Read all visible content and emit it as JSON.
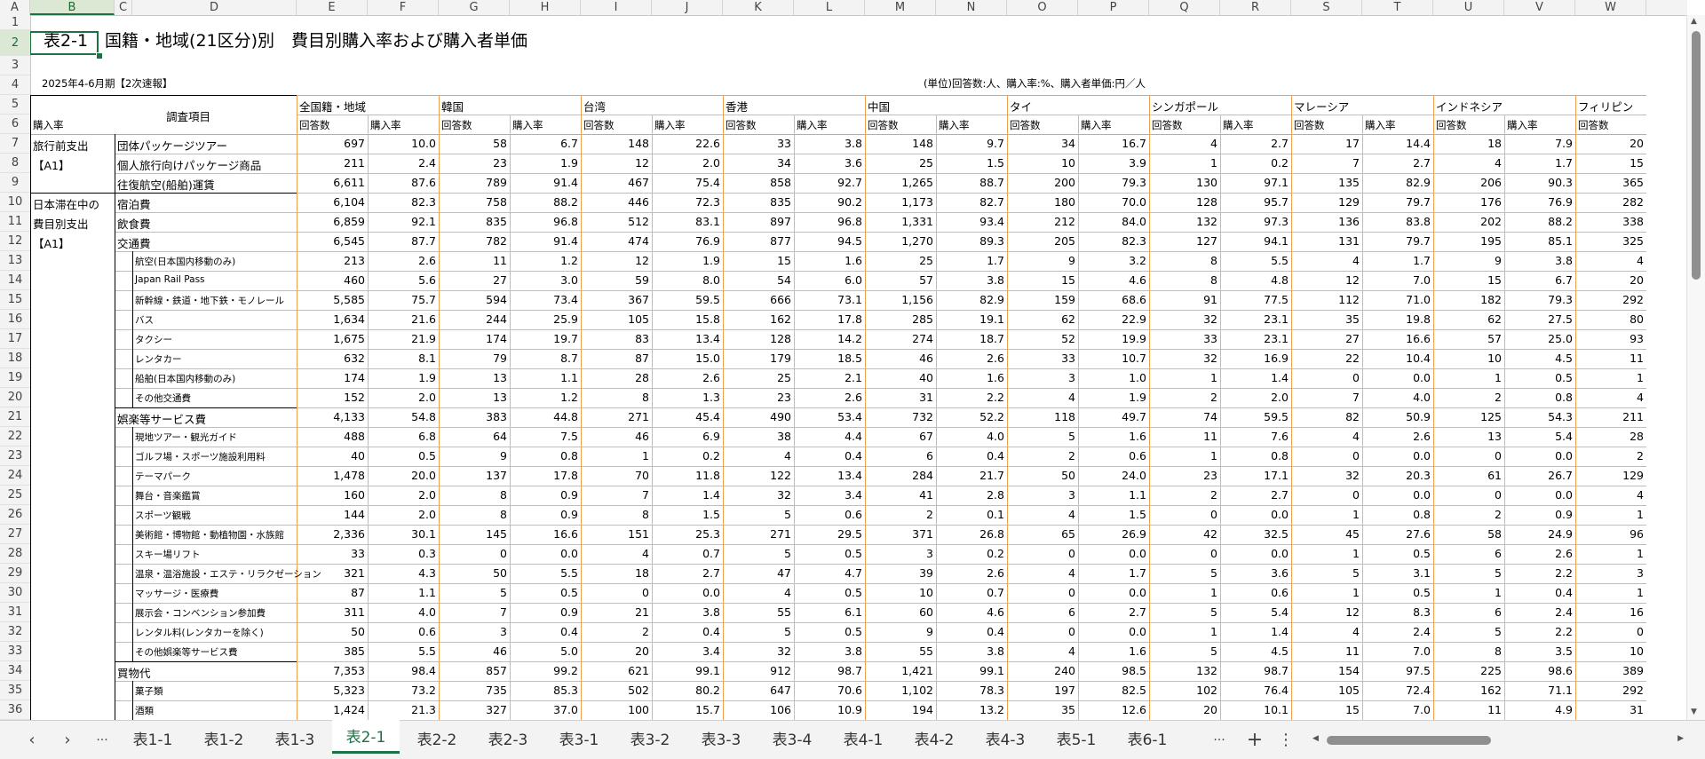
{
  "sheet": {
    "name_box_cell": "B2",
    "title": "表2-1　国籍・地域(21区分)別　費目別購入率および購入者単価",
    "period": "2025年4-6月期【2次速報】",
    "units": "(単位)回答数:人、購入率:%、購入者単価:円／人",
    "item_header": "調査項目",
    "sub_headers": [
      "回答数",
      "購入率"
    ],
    "countries": [
      "全国籍・地域",
      "韓国",
      "台湾",
      "香港",
      "中国",
      "タイ",
      "シンガポール",
      "マレーシア",
      "インドネシア",
      "フィリピン"
    ],
    "col_letters": [
      "A",
      "B",
      "C",
      "D",
      "E",
      "F",
      "G",
      "H",
      "I",
      "J",
      "K",
      "L",
      "M",
      "N",
      "O",
      "P",
      "Q",
      "R",
      "S",
      "T",
      "U",
      "V",
      "W"
    ],
    "row_numbers": [
      "1",
      "2",
      "3",
      "4",
      "5",
      "6",
      "7",
      "8",
      "9",
      "10",
      "11",
      "12",
      "13",
      "14",
      "15",
      "16",
      "17",
      "18",
      "19",
      "20",
      "21",
      "22",
      "23",
      "24",
      "25",
      "26",
      "27",
      "28",
      "29",
      "30",
      "31",
      "32",
      "33",
      "34",
      "35",
      "36"
    ],
    "category_labels": [
      {
        "row": 7,
        "text": "旅行前支出"
      },
      {
        "row": 8,
        "text": "【A1】"
      },
      {
        "row": 10,
        "text": "日本滞在中の"
      },
      {
        "row": 11,
        "text": "費目別支出"
      },
      {
        "row": 12,
        "text": "【A1】"
      }
    ],
    "rows": [
      {
        "label": "団体パッケージツアー",
        "level": 1,
        "values": [
          "697",
          "10.0",
          "58",
          "6.7",
          "148",
          "22.6",
          "33",
          "3.8",
          "148",
          "9.7",
          "34",
          "16.7",
          "4",
          "2.7",
          "17",
          "14.4",
          "18",
          "7.9",
          "20"
        ]
      },
      {
        "label": "個人旅行向けパッケージ商品",
        "level": 1,
        "values": [
          "211",
          "2.4",
          "23",
          "1.9",
          "12",
          "2.0",
          "34",
          "3.6",
          "25",
          "1.5",
          "10",
          "3.9",
          "1",
          "0.2",
          "7",
          "2.7",
          "4",
          "1.7",
          "15"
        ]
      },
      {
        "label": "往復航空(船舶)運賃",
        "level": 1,
        "values": [
          "6,611",
          "87.6",
          "789",
          "91.4",
          "467",
          "75.4",
          "858",
          "92.7",
          "1,265",
          "88.7",
          "200",
          "79.3",
          "130",
          "97.1",
          "135",
          "82.9",
          "206",
          "90.3",
          "365"
        ]
      },
      {
        "label": "宿泊費",
        "level": 1,
        "values": [
          "6,104",
          "82.3",
          "758",
          "88.2",
          "446",
          "72.3",
          "835",
          "90.2",
          "1,173",
          "82.7",
          "180",
          "70.0",
          "128",
          "95.7",
          "129",
          "79.7",
          "176",
          "76.9",
          "282"
        ]
      },
      {
        "label": "飲食費",
        "level": 1,
        "values": [
          "6,859",
          "92.1",
          "835",
          "96.8",
          "512",
          "83.1",
          "897",
          "96.8",
          "1,331",
          "93.4",
          "212",
          "84.0",
          "132",
          "97.3",
          "136",
          "83.8",
          "202",
          "88.2",
          "338"
        ]
      },
      {
        "label": "交通費",
        "level": 1,
        "values": [
          "6,545",
          "87.7",
          "782",
          "91.4",
          "474",
          "76.9",
          "877",
          "94.5",
          "1,270",
          "89.3",
          "205",
          "82.3",
          "127",
          "94.1",
          "131",
          "79.7",
          "195",
          "85.1",
          "325"
        ]
      },
      {
        "label": "航空(日本国内移動のみ)",
        "level": 2,
        "values": [
          "213",
          "2.6",
          "11",
          "1.2",
          "12",
          "1.9",
          "15",
          "1.6",
          "25",
          "1.7",
          "9",
          "3.2",
          "8",
          "5.5",
          "4",
          "1.7",
          "9",
          "3.8",
          "4"
        ]
      },
      {
        "label": "Japan Rail Pass",
        "level": 2,
        "values": [
          "460",
          "5.6",
          "27",
          "3.0",
          "59",
          "8.0",
          "54",
          "6.0",
          "57",
          "3.8",
          "15",
          "4.6",
          "8",
          "4.8",
          "12",
          "7.0",
          "15",
          "6.7",
          "20"
        ]
      },
      {
        "label": "新幹線・鉄道・地下鉄・モノレール",
        "level": 2,
        "values": [
          "5,585",
          "75.7",
          "594",
          "73.4",
          "367",
          "59.5",
          "666",
          "73.1",
          "1,156",
          "82.9",
          "159",
          "68.6",
          "91",
          "77.5",
          "112",
          "71.0",
          "182",
          "79.3",
          "292"
        ]
      },
      {
        "label": "バス",
        "level": 2,
        "values": [
          "1,634",
          "21.6",
          "244",
          "25.9",
          "105",
          "15.8",
          "162",
          "17.8",
          "285",
          "19.1",
          "62",
          "22.9",
          "32",
          "23.1",
          "35",
          "19.8",
          "62",
          "27.5",
          "80"
        ]
      },
      {
        "label": "タクシー",
        "level": 2,
        "values": [
          "1,675",
          "21.9",
          "174",
          "19.7",
          "83",
          "13.4",
          "128",
          "14.2",
          "274",
          "18.7",
          "52",
          "19.9",
          "33",
          "23.1",
          "27",
          "16.6",
          "57",
          "25.0",
          "93"
        ]
      },
      {
        "label": "レンタカー",
        "level": 2,
        "values": [
          "632",
          "8.1",
          "79",
          "8.7",
          "87",
          "15.0",
          "179",
          "18.5",
          "46",
          "2.6",
          "33",
          "10.7",
          "32",
          "16.9",
          "22",
          "10.4",
          "10",
          "4.5",
          "11"
        ]
      },
      {
        "label": "船舶(日本国内移動のみ)",
        "level": 2,
        "values": [
          "174",
          "1.9",
          "13",
          "1.1",
          "28",
          "2.6",
          "25",
          "2.1",
          "40",
          "1.6",
          "3",
          "1.0",
          "1",
          "1.4",
          "0",
          "0.0",
          "1",
          "0.5",
          "1"
        ]
      },
      {
        "label": "その他交通費",
        "level": 2,
        "values": [
          "152",
          "2.0",
          "13",
          "1.2",
          "8",
          "1.3",
          "23",
          "2.6",
          "31",
          "2.2",
          "4",
          "1.9",
          "2",
          "2.0",
          "7",
          "4.0",
          "2",
          "0.8",
          "4"
        ]
      },
      {
        "label": "娯楽等サービス費",
        "level": 1,
        "values": [
          "4,133",
          "54.8",
          "383",
          "44.8",
          "271",
          "45.4",
          "490",
          "53.4",
          "732",
          "52.2",
          "118",
          "49.7",
          "74",
          "59.5",
          "82",
          "50.9",
          "125",
          "54.3",
          "211"
        ]
      },
      {
        "label": "現地ツアー・観光ガイド",
        "level": 2,
        "values": [
          "488",
          "6.8",
          "64",
          "7.5",
          "46",
          "6.9",
          "38",
          "4.4",
          "67",
          "4.0",
          "5",
          "1.6",
          "11",
          "7.6",
          "4",
          "2.6",
          "13",
          "5.4",
          "28"
        ]
      },
      {
        "label": "ゴルフ場・スポーツ施設利用料",
        "level": 2,
        "values": [
          "40",
          "0.5",
          "9",
          "0.8",
          "1",
          "0.2",
          "4",
          "0.4",
          "6",
          "0.4",
          "2",
          "0.6",
          "1",
          "0.8",
          "0",
          "0.0",
          "0",
          "0.0",
          "2"
        ]
      },
      {
        "label": "テーマパーク",
        "level": 2,
        "values": [
          "1,478",
          "20.0",
          "137",
          "17.8",
          "70",
          "11.8",
          "122",
          "13.4",
          "284",
          "21.7",
          "50",
          "24.0",
          "23",
          "17.1",
          "32",
          "20.3",
          "61",
          "26.7",
          "129"
        ]
      },
      {
        "label": "舞台・音楽鑑賞",
        "level": 2,
        "values": [
          "160",
          "2.0",
          "8",
          "0.9",
          "7",
          "1.4",
          "32",
          "3.4",
          "41",
          "2.8",
          "3",
          "1.1",
          "2",
          "2.7",
          "0",
          "0.0",
          "0",
          "0.0",
          "4"
        ]
      },
      {
        "label": "スポーツ観戦",
        "level": 2,
        "values": [
          "144",
          "2.0",
          "8",
          "0.9",
          "8",
          "1.5",
          "5",
          "0.6",
          "2",
          "0.1",
          "4",
          "1.5",
          "0",
          "0.0",
          "1",
          "0.8",
          "2",
          "0.9",
          "1"
        ]
      },
      {
        "label": "美術館・博物館・動植物園・水族館",
        "level": 2,
        "values": [
          "2,336",
          "30.1",
          "145",
          "16.6",
          "151",
          "25.3",
          "271",
          "29.5",
          "371",
          "26.8",
          "65",
          "26.9",
          "42",
          "32.5",
          "45",
          "27.6",
          "58",
          "24.9",
          "96"
        ]
      },
      {
        "label": "スキー場リフト",
        "level": 2,
        "values": [
          "33",
          "0.3",
          "0",
          "0.0",
          "4",
          "0.7",
          "5",
          "0.5",
          "3",
          "0.2",
          "0",
          "0.0",
          "0",
          "0.0",
          "1",
          "0.5",
          "6",
          "2.6",
          "1"
        ]
      },
      {
        "label": "温泉・温浴施設・エステ・リラクゼーション",
        "level": 2,
        "values": [
          "321",
          "4.3",
          "50",
          "5.5",
          "18",
          "2.7",
          "47",
          "4.7",
          "39",
          "2.6",
          "4",
          "1.7",
          "5",
          "3.6",
          "5",
          "3.1",
          "5",
          "2.2",
          "3"
        ]
      },
      {
        "label": "マッサージ・医療費",
        "level": 2,
        "values": [
          "87",
          "1.1",
          "5",
          "0.5",
          "0",
          "0.0",
          "4",
          "0.5",
          "10",
          "0.7",
          "0",
          "0.0",
          "1",
          "0.6",
          "1",
          "0.5",
          "1",
          "0.4",
          "1"
        ]
      },
      {
        "label": "展示会・コンベンション参加費",
        "level": 2,
        "values": [
          "311",
          "4.0",
          "7",
          "0.9",
          "21",
          "3.8",
          "55",
          "6.1",
          "60",
          "4.6",
          "6",
          "2.7",
          "5",
          "5.4",
          "12",
          "8.3",
          "6",
          "2.4",
          "16"
        ]
      },
      {
        "label": "レンタル料(レンタカーを除く)",
        "level": 2,
        "values": [
          "50",
          "0.6",
          "3",
          "0.4",
          "2",
          "0.4",
          "5",
          "0.5",
          "9",
          "0.4",
          "0",
          "0.0",
          "1",
          "1.4",
          "4",
          "2.4",
          "5",
          "2.2",
          "0"
        ]
      },
      {
        "label": "その他娯楽等サービス費",
        "level": 2,
        "values": [
          "385",
          "5.5",
          "46",
          "5.0",
          "20",
          "3.4",
          "32",
          "3.8",
          "55",
          "3.8",
          "4",
          "1.6",
          "5",
          "4.5",
          "11",
          "7.0",
          "8",
          "3.5",
          "10"
        ]
      },
      {
        "label": "買物代",
        "level": 1,
        "values": [
          "7,353",
          "98.4",
          "857",
          "99.2",
          "621",
          "99.1",
          "912",
          "98.7",
          "1,421",
          "99.1",
          "240",
          "98.5",
          "132",
          "98.7",
          "154",
          "97.5",
          "225",
          "98.6",
          "389"
        ]
      },
      {
        "label": "菓子類",
        "level": 2,
        "values": [
          "5,323",
          "73.2",
          "735",
          "85.3",
          "502",
          "80.2",
          "647",
          "70.6",
          "1,102",
          "78.3",
          "197",
          "82.5",
          "102",
          "76.4",
          "105",
          "72.4",
          "162",
          "71.1",
          "292"
        ]
      },
      {
        "label": "酒類",
        "level": 2,
        "values": [
          "1,424",
          "21.3",
          "327",
          "37.0",
          "100",
          "15.7",
          "106",
          "10.9",
          "194",
          "13.2",
          "35",
          "12.6",
          "20",
          "10.1",
          "15",
          "7.0",
          "11",
          "4.9",
          "31"
        ]
      }
    ]
  },
  "tabs": [
    "表1-1",
    "表1-2",
    "表1-3",
    "表2-1",
    "表2-2",
    "表2-3",
    "表3-1",
    "表3-2",
    "表3-3",
    "表3-4",
    "表4-1",
    "表4-2",
    "表4-3",
    "表5-1",
    "表6-1"
  ],
  "active_tab": "表2-1",
  "nav": {
    "prev": "‹",
    "next": "›",
    "more_left": "···",
    "more_right": "···",
    "add": "+",
    "menu": "⋮"
  },
  "colors": {
    "accent": "#1e7145",
    "header_border": "#f0a050"
  }
}
